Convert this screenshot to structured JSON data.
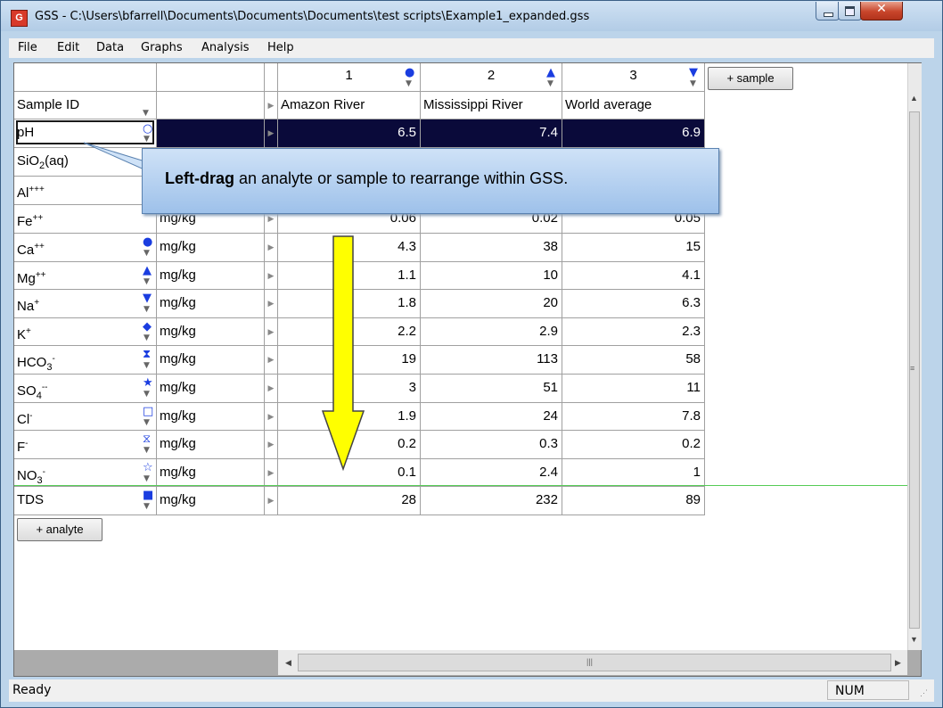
{
  "window": {
    "title": "GSS - C:\\Users\\bfarrell\\Documents\\Documents\\Documents\\test scripts\\Example1_expanded.gss"
  },
  "menu": [
    "File",
    "Edit",
    "Data",
    "Graphs",
    "Analysis",
    "Help"
  ],
  "grid": {
    "sample_numbers": [
      "1",
      "2",
      "3"
    ],
    "sample_symbols": [
      "●",
      "▲",
      "▼"
    ],
    "sample_symbol_colors": [
      "#1a3de0",
      "#1a3de0",
      "#1a3de0"
    ],
    "add_sample_label": "+ sample",
    "sample_id_label": "Sample ID",
    "sample_names": [
      "Amazon River",
      "Mississippi River",
      "World average"
    ],
    "rows": [
      {
        "name": "pH",
        "symbol": "○",
        "unit": "",
        "values": [
          "6.5",
          "7.4",
          "6.9"
        ]
      },
      {
        "name": "SiO2(aq)",
        "symbol": "",
        "unit": "",
        "values": [
          "",
          "",
          ""
        ]
      },
      {
        "name": "Al+++",
        "symbol": "",
        "unit": "",
        "values": [
          "",
          "",
          ""
        ]
      },
      {
        "name": "Fe++",
        "symbol": "◦",
        "unit": "mg/kg",
        "values": [
          "0.06",
          "0.02",
          "0.05"
        ]
      },
      {
        "name": "Ca++",
        "symbol": "●",
        "unit": "mg/kg",
        "values": [
          "4.3",
          "38",
          "15"
        ]
      },
      {
        "name": "Mg++",
        "symbol": "▲",
        "unit": "mg/kg",
        "values": [
          "1.1",
          "10",
          "4.1"
        ]
      },
      {
        "name": "Na+",
        "symbol": "▼",
        "unit": "mg/kg",
        "values": [
          "1.8",
          "20",
          "6.3"
        ]
      },
      {
        "name": "K+",
        "symbol": "◆",
        "unit": "mg/kg",
        "values": [
          "2.2",
          "2.9",
          "2.3"
        ]
      },
      {
        "name": "HCO3-",
        "symbol": "⧗",
        "unit": "mg/kg",
        "values": [
          "19",
          "113",
          "58"
        ]
      },
      {
        "name": "SO4--",
        "symbol": "★",
        "unit": "mg/kg",
        "values": [
          "3",
          "51",
          "11"
        ]
      },
      {
        "name": "Cl-",
        "symbol": "□",
        "unit": "mg/kg",
        "values": [
          "1.9",
          "24",
          "7.8"
        ]
      },
      {
        "name": "F-",
        "symbol": "⧖",
        "unit": "mg/kg",
        "values": [
          "0.2",
          "0.3",
          "0.2"
        ]
      },
      {
        "name": "NO3-",
        "symbol": "☆",
        "unit": "mg/kg",
        "values": [
          "0.1",
          "2.4",
          "1"
        ]
      },
      {
        "name": "TDS",
        "symbol": "■",
        "unit": "mg/kg",
        "values": [
          "28",
          "232",
          "89"
        ]
      }
    ],
    "add_analyte_label": "+ analyte"
  },
  "callout": {
    "bold": "Left-drag",
    "rest": " an analyte or sample to rearrange within GSS."
  },
  "status": {
    "text": "Ready",
    "num": "NUM"
  },
  "colors": {
    "selection": "#0a0a3a",
    "drop_line": "#55cc55",
    "arrow_fill": "#ffff00"
  }
}
